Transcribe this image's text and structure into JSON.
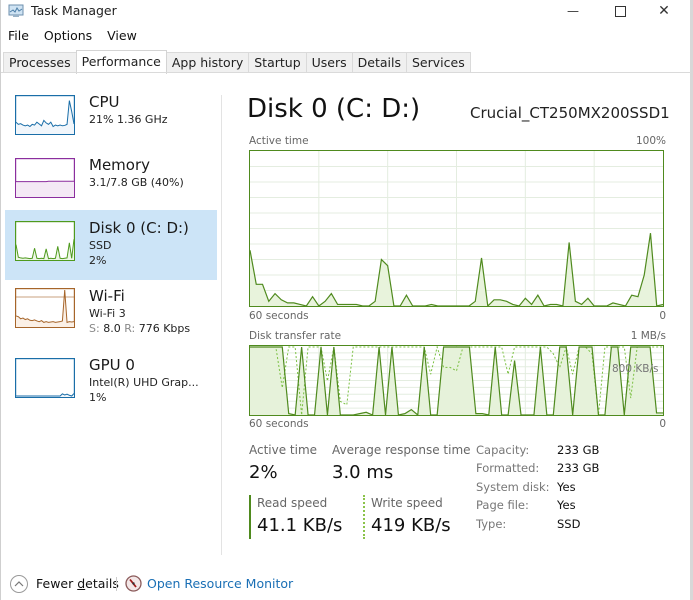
{
  "window": {
    "title": "Task Manager",
    "minimize_icon": "minimize-icon",
    "maximize_icon": "maximize-icon",
    "close_icon": "close-icon",
    "minimize_glyph": "—",
    "maximize_glyph": "☐",
    "close_glyph": "✕"
  },
  "menu": [
    "File",
    "Options",
    "View"
  ],
  "tabs": [
    {
      "label": "Processes",
      "active": false
    },
    {
      "label": "Performance",
      "active": true
    },
    {
      "label": "App history",
      "active": false
    },
    {
      "label": "Startup",
      "active": false
    },
    {
      "label": "Users",
      "active": false
    },
    {
      "label": "Details",
      "active": false
    },
    {
      "label": "Services",
      "active": false
    }
  ],
  "sidebar": {
    "items": [
      {
        "name": "CPU",
        "line1": "21% 1.36 GHz",
        "line2": "",
        "color": "#1a6ea8",
        "fill": "#f1f6fb",
        "selected": false
      },
      {
        "name": "Memory",
        "line1": "3.1/7.8 GB (40%)",
        "line2": "",
        "color": "#8b2e9e",
        "fill": "#f4e9f5",
        "selected": false
      },
      {
        "name": "Disk 0 (C: D:)",
        "line1": "SSD",
        "line2": "2%",
        "color": "#4f9a1e",
        "fill": "#eef7e6",
        "selected": true
      },
      {
        "name": "Wi-Fi",
        "line1": "Wi-Fi 3",
        "line2_send_label": "S:",
        "line2_send": "8.0",
        "line2_recv_label": "R:",
        "line2_recv": "776 Kbps",
        "color": "#a6652a",
        "fill": "#fbf0e6",
        "selected": false
      },
      {
        "name": "GPU 0",
        "line1": "Intel(R) UHD Grap...",
        "line2": "1%",
        "color": "#1a6ea8",
        "fill": "#f1f6fb",
        "selected": false
      }
    ]
  },
  "main": {
    "title": "Disk 0 (C: D:)",
    "device": "Crucial_CT250MX200SSD1",
    "stats": {
      "active_time_label": "Active time",
      "active_time_value": "2%",
      "avg_response_label": "Average response time",
      "avg_response_value": "3.0 ms",
      "read_label": "Read speed",
      "read_value": "41.1 KB/s",
      "write_label": "Write speed",
      "write_value": "419 KB/s"
    },
    "info": [
      {
        "key": "Capacity:",
        "value": "233 GB"
      },
      {
        "key": "Formatted:",
        "value": "233 GB"
      },
      {
        "key": "System disk:",
        "value": "Yes"
      },
      {
        "key": "Page file:",
        "value": "Yes"
      },
      {
        "key": "Type:",
        "value": "SSD"
      }
    ]
  },
  "chart_data": [
    {
      "type": "area",
      "title": "Active time",
      "ymax_label": "100%",
      "xlabel_left": "60 seconds",
      "xlabel_right": "0",
      "ylim": [
        0,
        100
      ],
      "xlim": [
        60,
        0
      ],
      "grid": true,
      "color": "#4f8a1e",
      "fill": "#e8f3dc",
      "values": [
        36,
        14,
        14,
        3,
        8,
        4,
        2,
        2,
        1,
        0,
        6,
        0,
        3,
        8,
        1,
        1,
        1,
        1,
        0,
        0,
        3,
        30,
        26,
        0,
        0,
        7,
        0,
        0,
        0,
        1,
        0,
        0,
        0,
        0,
        0,
        0,
        3,
        31,
        0,
        4,
        4,
        3,
        1,
        0,
        5,
        1,
        7,
        0,
        1,
        1,
        0,
        41,
        3,
        1,
        5,
        0,
        0,
        0,
        2,
        1,
        0,
        7,
        6,
        20,
        47,
        0,
        1
      ]
    },
    {
      "type": "line",
      "title": "Disk transfer rate",
      "ymax_label": "1 MB/s",
      "annotation": "800 KB/s",
      "xlabel_left": "60 seconds",
      "xlabel_right": "0",
      "ylim": [
        0,
        1000
      ],
      "unit": "KB/s",
      "grid": true,
      "series": [
        {
          "name": "Read speed",
          "style": "solid",
          "color": "#4f8a1e",
          "values": [
            1000,
            1000,
            1000,
            1000,
            1000,
            1000,
            20,
            0,
            1000,
            0,
            0,
            1000,
            0,
            1000,
            0,
            0,
            0,
            20,
            40,
            0,
            1000,
            0,
            1000,
            0,
            20,
            80,
            0,
            1000,
            0,
            0,
            1000,
            1000,
            1000,
            1000,
            1000,
            20,
            20,
            0,
            1000,
            0,
            0,
            800,
            0,
            0,
            0,
            1000,
            0,
            0,
            1000,
            1000,
            0,
            1000,
            1000,
            1000,
            0,
            0,
            1000,
            1000,
            0,
            1000,
            1000,
            1000,
            1000,
            30,
            30
          ]
        },
        {
          "name": "Write speed",
          "style": "dashed",
          "color": "#7bc043",
          "values": [
            1000,
            1000,
            1000,
            1000,
            1000,
            400,
            1000,
            1000,
            0,
            1000,
            1000,
            1000,
            500,
            1000,
            200,
            150,
            1000,
            1000,
            1000,
            1000,
            1000,
            1000,
            1000,
            1000,
            1000,
            1000,
            1000,
            1000,
            600,
            1000,
            700,
            700,
            650,
            1000,
            1000,
            1000,
            1000,
            1000,
            1000,
            1000,
            600,
            1000,
            1000,
            1000,
            1000,
            1000,
            1000,
            900,
            700,
            1000,
            600,
            1000,
            1000,
            900,
            0,
            1000,
            1000,
            1000,
            1000,
            250,
            1000,
            1000,
            1000,
            1000,
            1000
          ]
        }
      ]
    },
    {
      "type": "line",
      "title": "CPU thumbnail",
      "ylim": [
        0,
        100
      ],
      "color": "#1a6ea8",
      "values": [
        30,
        24,
        26,
        22,
        20,
        22,
        18,
        24,
        22,
        30,
        25,
        20,
        35,
        28,
        24,
        30,
        18,
        22,
        20,
        22,
        20,
        21,
        24,
        90,
        60,
        25
      ]
    },
    {
      "type": "line",
      "title": "Memory thumbnail",
      "ylim": [
        0,
        100
      ],
      "color": "#8b2e9e",
      "values": [
        40,
        40,
        40,
        40,
        40,
        40,
        40,
        40,
        40,
        40,
        40,
        40,
        40,
        40,
        41,
        41,
        41,
        41,
        41,
        41,
        41,
        41,
        41,
        41,
        41,
        41
      ]
    },
    {
      "type": "area",
      "title": "Disk thumbnail",
      "ylim": [
        0,
        100
      ],
      "color": "#4f9a1e",
      "values": [
        40,
        5,
        3,
        2,
        3,
        2,
        1,
        2,
        30,
        2,
        1,
        2,
        1,
        28,
        1,
        2,
        1,
        2,
        35,
        2,
        1,
        2,
        3,
        45,
        2,
        55
      ]
    },
    {
      "type": "line",
      "title": "Wi-Fi thumbnail",
      "ylim": [
        0,
        100
      ],
      "color": "#a6652a",
      "values": [
        28,
        26,
        20,
        22,
        18,
        20,
        16,
        15,
        17,
        14,
        12,
        15,
        10,
        12,
        10,
        11,
        12,
        10,
        11,
        12,
        14,
        100,
        10,
        12,
        11,
        12
      ]
    },
    {
      "type": "line",
      "title": "GPU thumbnail",
      "ylim": [
        0,
        100
      ],
      "color": "#1a6ea8",
      "values": [
        0,
        0,
        0,
        0,
        0,
        0,
        0,
        0,
        0,
        0,
        0,
        0,
        0,
        0,
        0,
        0,
        0,
        0,
        0,
        0,
        6,
        3,
        5,
        2,
        0,
        7
      ]
    }
  ],
  "footer": {
    "fewer_details": "Fewer details",
    "fewer_details_underline_char": "d",
    "open_resource_monitor": "Open Resource Monitor"
  }
}
